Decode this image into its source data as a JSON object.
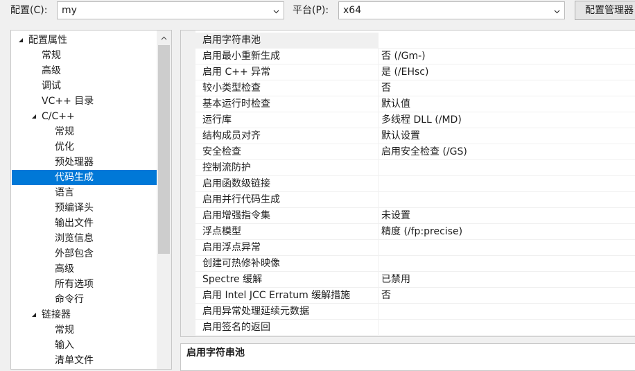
{
  "toolbar": {
    "config_label": "配置(C):",
    "config_value": "my",
    "platform_label": "平台(P):",
    "platform_value": "x64",
    "config_manager_button": "配置管理器"
  },
  "tree": {
    "items": [
      {
        "label": "配置属性",
        "level": 0,
        "expanded": true
      },
      {
        "label": "常规",
        "level": 1
      },
      {
        "label": "高级",
        "level": 1
      },
      {
        "label": "调试",
        "level": 1
      },
      {
        "label": "VC++ 目录",
        "level": 1
      },
      {
        "label": "C/C++",
        "level": 1,
        "expanded": true
      },
      {
        "label": "常规",
        "level": 2
      },
      {
        "label": "优化",
        "level": 2
      },
      {
        "label": "预处理器",
        "level": 2
      },
      {
        "label": "代码生成",
        "level": 2,
        "selected": true
      },
      {
        "label": "语言",
        "level": 2
      },
      {
        "label": "预编译头",
        "level": 2
      },
      {
        "label": "输出文件",
        "level": 2
      },
      {
        "label": "浏览信息",
        "level": 2
      },
      {
        "label": "外部包含",
        "level": 2
      },
      {
        "label": "高级",
        "level": 2
      },
      {
        "label": "所有选项",
        "level": 2
      },
      {
        "label": "命令行",
        "level": 2
      },
      {
        "label": "链接器",
        "level": 1,
        "expanded": true
      },
      {
        "label": "常规",
        "level": 2
      },
      {
        "label": "输入",
        "level": 2
      },
      {
        "label": "清单文件",
        "level": 2
      }
    ]
  },
  "properties": [
    {
      "name": "启用字符串池",
      "value": ""
    },
    {
      "name": "启用最小重新生成",
      "value": "否 (/Gm-)"
    },
    {
      "name": "启用 C++ 异常",
      "value": "是 (/EHsc)"
    },
    {
      "name": "较小类型检查",
      "value": "否"
    },
    {
      "name": "基本运行时检查",
      "value": "默认值"
    },
    {
      "name": "运行库",
      "value": "多线程 DLL (/MD)"
    },
    {
      "name": "结构成员对齐",
      "value": "默认设置"
    },
    {
      "name": "安全检查",
      "value": "启用安全检查 (/GS)"
    },
    {
      "name": "控制流防护",
      "value": ""
    },
    {
      "name": "启用函数级链接",
      "value": ""
    },
    {
      "name": "启用并行代码生成",
      "value": ""
    },
    {
      "name": "启用增强指令集",
      "value": "未设置"
    },
    {
      "name": "浮点模型",
      "value": "精度 (/fp:precise)"
    },
    {
      "name": "启用浮点异常",
      "value": ""
    },
    {
      "name": "创建可热修补映像",
      "value": ""
    },
    {
      "name": "Spectre 缓解",
      "value": "已禁用"
    },
    {
      "name": "启用 Intel JCC Erratum 缓解措施",
      "value": "否"
    },
    {
      "name": "启用异常处理延续元数据",
      "value": ""
    },
    {
      "name": "启用签名的返回",
      "value": ""
    }
  ],
  "description": {
    "title": "启用字符串池"
  },
  "colors": {
    "selection": "#0078d7",
    "window_bg": "#f0f0f0"
  }
}
